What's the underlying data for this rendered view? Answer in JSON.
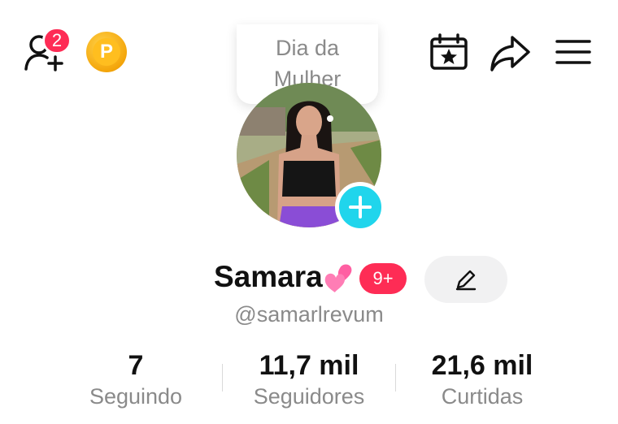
{
  "topbar": {
    "friend_request_count": "2",
    "coin_letter": "P",
    "bubble_line1": "Dia da",
    "bubble_line2": "Mulher"
  },
  "profile": {
    "name": "Samara",
    "name_emoji": "💕",
    "notification_badge": "9+",
    "handle": "@samarlrevum"
  },
  "stats": [
    {
      "value": "7",
      "label": "Seguindo"
    },
    {
      "value": "11,7 mil",
      "label": "Seguidores"
    },
    {
      "value": "21,6 mil",
      "label": "Curtidas"
    }
  ],
  "colors": {
    "badge_red": "#fe2c55",
    "plus_cyan": "#20d5ec",
    "coin_gold": "#f4a60b",
    "secondary_text": "#8a8a8a"
  },
  "icons": [
    "add-friend-icon",
    "coin-icon",
    "calendar-star-icon",
    "share-icon",
    "menu-icon",
    "plus-icon",
    "pencil-icon",
    "hearts-icon"
  ]
}
